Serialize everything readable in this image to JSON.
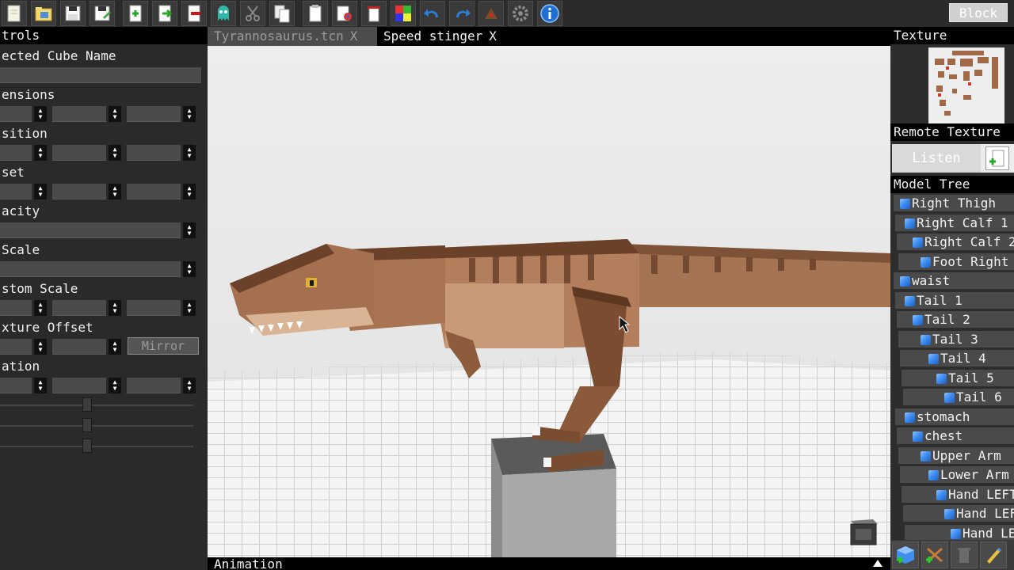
{
  "toolbar": {
    "icons": [
      "new-file-icon",
      "open-folder-icon",
      "save-icon",
      "save-as-icon",
      "import-icon",
      "export-icon",
      "close-file-icon",
      "ghost-icon",
      "cut-icon",
      "copy-icon",
      "paste-icon",
      "paste-special-icon",
      "delete-icon",
      "texture-palette-icon",
      "undo-icon",
      "redo-icon",
      "fly-camera-icon",
      "settings-icon",
      "info-icon"
    ],
    "block_label": "Block"
  },
  "left_panel": {
    "header": "trols",
    "cube_name_label": "ected Cube Name",
    "dimensions_label": "ensions",
    "position_label": "sition",
    "offset_label": "set",
    "opacity_label": "acity",
    "scale_label": "Scale",
    "custom_scale_label": "stom Scale",
    "texture_offset_label": "xture Offset",
    "mirror_label": "Mirror",
    "rotation_label": "ation"
  },
  "tabs": [
    {
      "label": "Tyrannosaurus.tcn",
      "close": "X",
      "active": true
    },
    {
      "label": "Speed stinger",
      "close": "X",
      "active": false
    }
  ],
  "viewport": {
    "animation_label": "Animation"
  },
  "right_panel": {
    "texture_header": "Texture",
    "remote_texture_header": "Remote Texture",
    "listen_label": "Listen",
    "model_tree_header": "Model Tree",
    "tree": [
      "Right Thigh",
      "Right Calf 1",
      "Right Calf 2",
      "Foot Right",
      "waist",
      "Tail 1",
      "Tail 2",
      "Tail 3",
      "Tail 4",
      "Tail 5",
      "Tail 6",
      "stomach",
      "chest",
      "Upper Arm",
      "Lower Arm",
      "Hand LEFT",
      "Hand LEFT",
      "Hand LEFT"
    ],
    "bottom_icons": [
      "add-cube-icon",
      "add-group-icon",
      "delete-icon",
      "edit-icon"
    ]
  },
  "colors": {
    "panel_dark": "#2a2a2a",
    "header_black": "#000000",
    "field_gray": "#4b4b4b",
    "cube_blue": "#3f8ef0",
    "info_blue": "#1e90ff",
    "dino_brown": "#9b6b4b"
  }
}
